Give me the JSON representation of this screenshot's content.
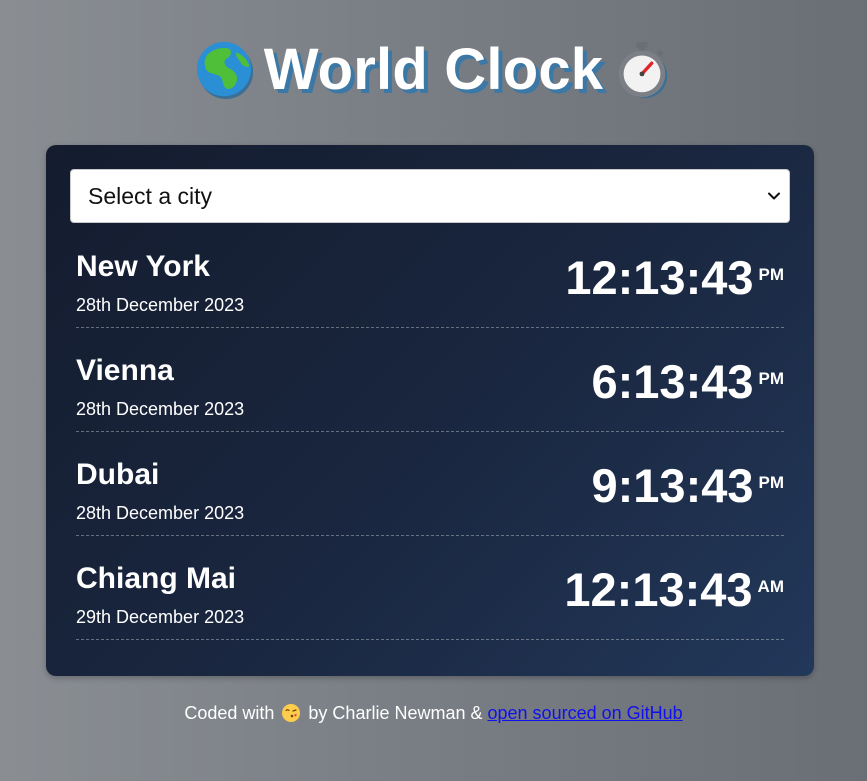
{
  "header": {
    "title": "World Clock",
    "left_icon": "globe-africa-europe-icon",
    "right_icon": "stopwatch-icon"
  },
  "selector": {
    "value": "Select a city",
    "icon": "chevron-down-icon"
  },
  "cities": [
    {
      "name": "New York",
      "date": "28th December 2023",
      "time": "12:13:43",
      "period": "PM"
    },
    {
      "name": "Vienna",
      "date": "28th December 2023",
      "time": "6:13:43",
      "period": "PM"
    },
    {
      "name": "Dubai",
      "date": "28th December 2023",
      "time": "9:13:43",
      "period": "PM"
    },
    {
      "name": "Chiang Mai",
      "date": "29th December 2023",
      "time": "12:13:43",
      "period": "AM"
    }
  ],
  "footer": {
    "prefix": "Coded with",
    "icon": "face-blowing-kiss-icon",
    "middle": "by Charlie Newman &",
    "link_text": "open sourced on GitHub"
  },
  "colors": {
    "card_bg": "#1a2740",
    "title_shadow": "#3c78a6",
    "link": "#1010ee"
  }
}
